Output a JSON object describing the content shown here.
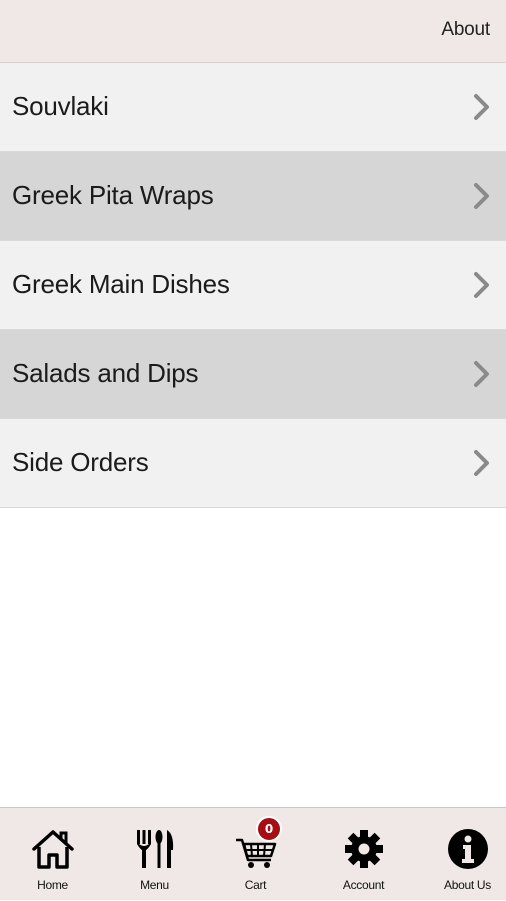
{
  "header": {
    "about_label": "About"
  },
  "menu": {
    "items": [
      {
        "label": "Souvlaki",
        "shade": "light"
      },
      {
        "label": "Greek Pita Wraps",
        "shade": "dark"
      },
      {
        "label": "Greek Main Dishes",
        "shade": "light"
      },
      {
        "label": "Salads and Dips",
        "shade": "dark"
      },
      {
        "label": "Side Orders",
        "shade": "light"
      }
    ],
    "chevron_icon": "chevron-right-icon"
  },
  "tabbar": {
    "tabs": [
      {
        "label": "Home",
        "icon": "home-icon"
      },
      {
        "label": "Menu",
        "icon": "fork-knife-icon"
      },
      {
        "label": "Cart",
        "icon": "cart-icon"
      },
      {
        "label": "Account",
        "icon": "gear-icon"
      },
      {
        "label": "About Us",
        "icon": "info-icon"
      }
    ],
    "cart_count": "0"
  },
  "colors": {
    "header_bg": "#efe8e6",
    "row_light": "#f1f1f1",
    "row_dark": "#d6d6d6",
    "badge": "#a60e14",
    "chevron": "#8a8a8a"
  }
}
